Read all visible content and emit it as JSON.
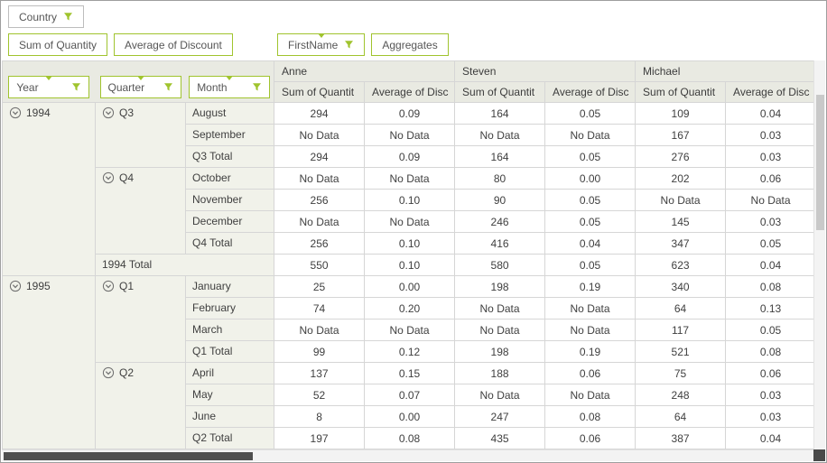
{
  "colors": {
    "accent": "#a0c42e",
    "header_bg": "#e9eae2",
    "row_header_bg": "#f1f2ea",
    "border": "#d6d6d6",
    "scroll_thumb_dark": "#4f4f4f"
  },
  "icons": {
    "filter": "funnel-icon",
    "collapse": "circled-chevron-down-icon"
  },
  "filter_area": {
    "fields": [
      {
        "label": "Country",
        "has_filter": true
      }
    ]
  },
  "value_area": {
    "fields": [
      {
        "label": "Sum of Quantity"
      },
      {
        "label": "Average of Discount"
      }
    ]
  },
  "column_area": {
    "fields": [
      {
        "label": "FirstName",
        "has_filter": true
      },
      {
        "label": "Aggregates"
      }
    ]
  },
  "row_area": {
    "fields": [
      {
        "label": "Year",
        "has_filter": true
      },
      {
        "label": "Quarter",
        "has_filter": true
      },
      {
        "label": "Month",
        "has_filter": true
      }
    ]
  },
  "column_headers": {
    "groups": [
      {
        "label": "Anne",
        "span": 2
      },
      {
        "label": "Steven",
        "span": 2
      },
      {
        "label": "Michael",
        "span": 2
      }
    ],
    "measures": [
      "Sum of Quantit",
      "Average of Disc",
      "Sum of Quantit",
      "Average of Disc",
      "Sum of Quantit",
      "Average of Disc"
    ]
  },
  "rows": [
    {
      "year": {
        "label": "1994",
        "span": 8,
        "expander": true
      },
      "quarter": {
        "label": "Q3",
        "span": 3,
        "expander": true
      },
      "month": "August",
      "cells": [
        "294",
        "0.09",
        "164",
        "0.05",
        "109",
        "0.04"
      ]
    },
    {
      "month": "September",
      "cells": [
        "No Data",
        "No Data",
        "No Data",
        "No Data",
        "167",
        "0.03"
      ]
    },
    {
      "month": "Q3 Total",
      "total_row": true,
      "cells": [
        "294",
        "0.09",
        "164",
        "0.05",
        "276",
        "0.03"
      ]
    },
    {
      "quarter": {
        "label": "Q4",
        "span": 4,
        "expander": true
      },
      "month": "October",
      "cells": [
        "No Data",
        "No Data",
        "80",
        "0.00",
        "202",
        "0.06"
      ]
    },
    {
      "month": "November",
      "cells": [
        "256",
        "0.10",
        "90",
        "0.05",
        "No Data",
        "No Data"
      ]
    },
    {
      "month": "December",
      "cells": [
        "No Data",
        "No Data",
        "246",
        "0.05",
        "145",
        "0.03"
      ]
    },
    {
      "month": "Q4 Total",
      "total_row": true,
      "cells": [
        "256",
        "0.10",
        "416",
        "0.04",
        "347",
        "0.05"
      ]
    },
    {
      "grand": {
        "label": "1994 Total",
        "colspan": 2
      },
      "total_row": true,
      "cells": [
        "550",
        "0.10",
        "580",
        "0.05",
        "623",
        "0.04"
      ]
    },
    {
      "year": {
        "label": "1995",
        "span": 8,
        "expander": true
      },
      "quarter": {
        "label": "Q1",
        "span": 4,
        "expander": true
      },
      "month": "January",
      "cells": [
        "25",
        "0.00",
        "198",
        "0.19",
        "340",
        "0.08"
      ]
    },
    {
      "month": "February",
      "cells": [
        "74",
        "0.20",
        "No Data",
        "No Data",
        "64",
        "0.13"
      ]
    },
    {
      "month": "March",
      "cells": [
        "No Data",
        "No Data",
        "No Data",
        "No Data",
        "117",
        "0.05"
      ]
    },
    {
      "month": "Q1 Total",
      "total_row": true,
      "cells": [
        "99",
        "0.12",
        "198",
        "0.19",
        "521",
        "0.08"
      ]
    },
    {
      "quarter": {
        "label": "Q2",
        "span": 4,
        "expander": true
      },
      "month": "April",
      "cells": [
        "137",
        "0.15",
        "188",
        "0.06",
        "75",
        "0.06"
      ]
    },
    {
      "month": "May",
      "cells": [
        "52",
        "0.07",
        "No Data",
        "No Data",
        "248",
        "0.03"
      ]
    },
    {
      "month": "June",
      "cells": [
        "8",
        "0.00",
        "247",
        "0.08",
        "64",
        "0.03"
      ]
    },
    {
      "month": "Q2 Total",
      "total_row": true,
      "cells": [
        "197",
        "0.08",
        "435",
        "0.06",
        "387",
        "0.04"
      ]
    }
  ]
}
